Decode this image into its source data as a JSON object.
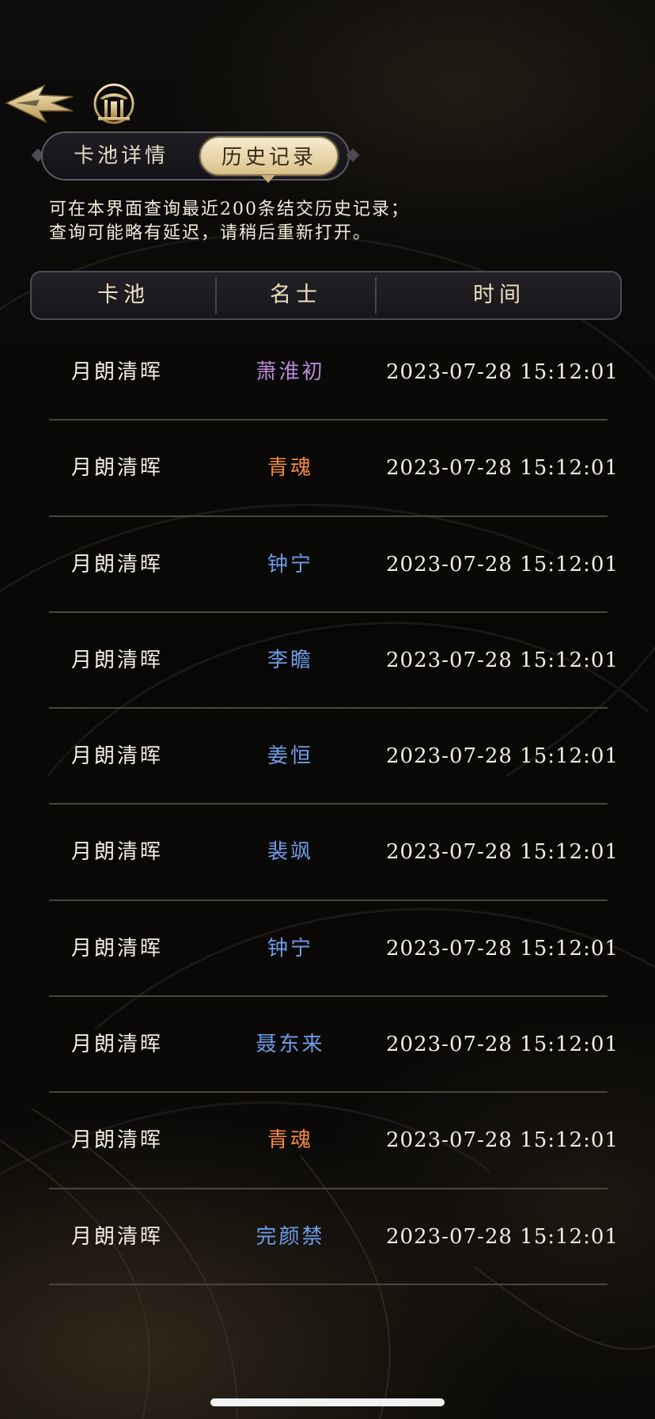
{
  "tabs": {
    "details_label": "卡池详情",
    "history_label": "历史记录",
    "active": "history"
  },
  "description": {
    "line1": "可在本界面查询最近200条结交历史记录；",
    "line2": "查询可能略有延迟，请稍后重新打开。"
  },
  "table": {
    "headers": {
      "pool": "卡池",
      "name": "名士",
      "time": "时间"
    },
    "rows": [
      {
        "pool": "月朗清晖",
        "name": "萧淮初",
        "name_color": "#b98ad6",
        "time": "2023-07-28 15:12:01"
      },
      {
        "pool": "月朗清晖",
        "name": "青魂",
        "name_color": "#f28a3e",
        "time": "2023-07-28 15:12:01"
      },
      {
        "pool": "月朗清晖",
        "name": "钟宁",
        "name_color": "#6e9ee8",
        "time": "2023-07-28 15:12:01"
      },
      {
        "pool": "月朗清晖",
        "name": "李瞻",
        "name_color": "#6e9ee8",
        "time": "2023-07-28 15:12:01"
      },
      {
        "pool": "月朗清晖",
        "name": "姜恒",
        "name_color": "#6e9ee8",
        "time": "2023-07-28 15:12:01"
      },
      {
        "pool": "月朗清晖",
        "name": "裴飒",
        "name_color": "#6e9ee8",
        "time": "2023-07-28 15:12:01"
      },
      {
        "pool": "月朗清晖",
        "name": "钟宁",
        "name_color": "#6e9ee8",
        "time": "2023-07-28 15:12:01"
      },
      {
        "pool": "月朗清晖",
        "name": "聂东来",
        "name_color": "#6e9ee8",
        "time": "2023-07-28 15:12:01"
      },
      {
        "pool": "月朗清晖",
        "name": "青魂",
        "name_color": "#f28a3e",
        "time": "2023-07-28 15:12:01"
      },
      {
        "pool": "月朗清晖",
        "name": "完颜禁",
        "name_color": "#6e9ee8",
        "time": "2023-07-28 15:12:01"
      }
    ]
  },
  "icons": {
    "back": "back-arrow-icon",
    "home": "home-pavilion-icon"
  },
  "colors": {
    "accent_gold": "#e8d6aa",
    "text_primary": "#f4eee2",
    "background": "#080706"
  }
}
